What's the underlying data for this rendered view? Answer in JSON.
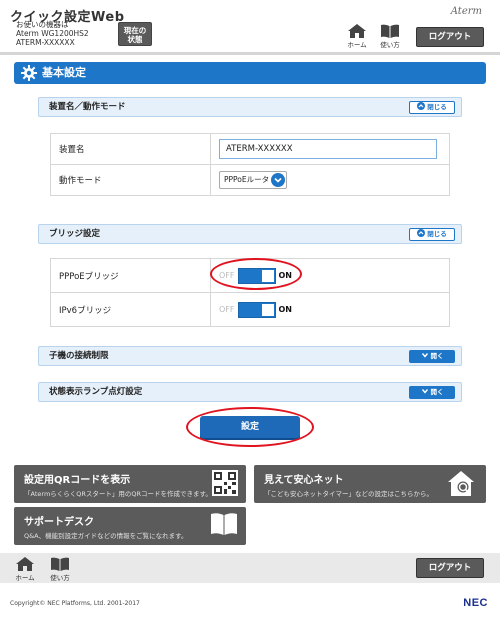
{
  "header": {
    "app_title": "クイック設定Web",
    "device_label": "お使いの機器は",
    "device_model": "Aterm WG1200HS2",
    "device_name": "ATERM-XXXXXX",
    "status_button_line1": "現在の",
    "status_button_line2": "状態",
    "brand": "Aterm",
    "home_label": "ホーム",
    "help_label": "使い方",
    "logout_label": "ログアウト"
  },
  "page": {
    "heading": "基本設定"
  },
  "sections": {
    "device": {
      "title": "装置名／動作モード",
      "toggle_label": "閉じる",
      "rows": {
        "name_label": "装置名",
        "name_value": "ATERM-XXXXXX",
        "mode_label": "動作モード",
        "mode_value": "PPPoEルータ"
      }
    },
    "bridge": {
      "title": "ブリッジ設定",
      "toggle_label": "閉じる",
      "rows": {
        "pppoe_label": "PPPoEブリッジ",
        "ipv6_label": "IPv6ブリッジ",
        "off_label": "OFF",
        "on_label": "ON"
      }
    },
    "restriction": {
      "title": "子機の接続制限",
      "toggle_label": "開く"
    },
    "lamp": {
      "title": "状態表示ランプ点灯設定",
      "toggle_label": "開く"
    }
  },
  "apply_button": "設定",
  "banners": {
    "qr": {
      "title": "設定用QRコードを表示",
      "subtitle": "「AtermらくらくQRスタート」用のQRコードを作成できます。"
    },
    "safety": {
      "title": "見えて安心ネット",
      "subtitle": "「こども安心ネットタイマー」などの設定はこちらから。"
    },
    "support": {
      "title": "サポートデスク",
      "subtitle": "Q&A、機能別設定ガイドなどの情報をご覧になれます。"
    }
  },
  "footer": {
    "home_label": "ホーム",
    "help_label": "使い方",
    "logout_label": "ログアウト",
    "copyright": "Copyright© NEC Platforms, Ltd. 2001-2017",
    "logo": "NEC"
  },
  "colors": {
    "accent": "#1e76c9",
    "highlight": "#e0131f",
    "banner": "#5b5b5b"
  }
}
